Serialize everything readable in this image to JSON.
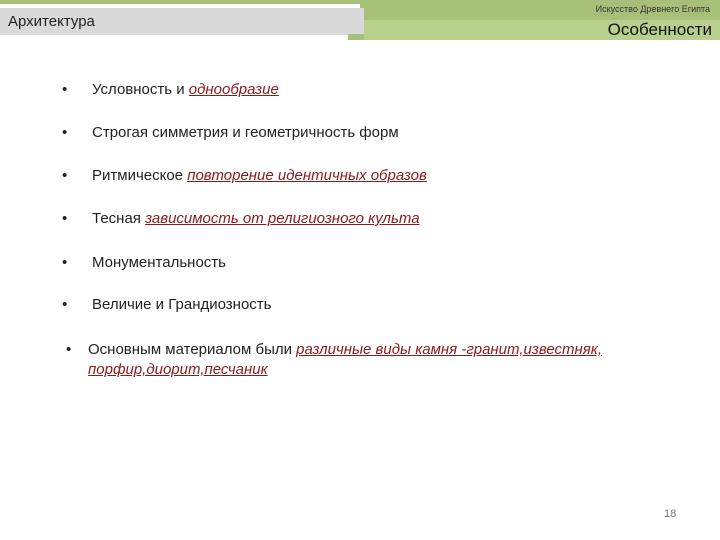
{
  "header": {
    "section": "Архитектура",
    "caption": "Искусство Древнего Египта",
    "title": "Особенности"
  },
  "bullets": [
    {
      "plain": "Условность и ",
      "underlined": "однообразие",
      "tail": ""
    },
    {
      "plain": "Строгая симметрия и геометричность форм",
      "underlined": "",
      "tail": ""
    },
    {
      "plain": "Ритмическое ",
      "underlined": "повторение идентичных образов",
      "tail": ""
    },
    {
      "plain": "Тесная ",
      "underlined": "зависимость от  религиозного культа",
      "tail": ""
    },
    {
      "plain": "Монументальность",
      "underlined": "",
      "tail": ""
    },
    {
      "plain": "Величие и  Грандиозность",
      "underlined": "",
      "tail": ""
    }
  ],
  "material": {
    "plain": "Основным материалом были ",
    "underlined": "различные виды камня -гранит,известняк,",
    "underlined2": "порфир,диорит,песчаник"
  },
  "bullet_symbol": "•",
  "page_number": "18",
  "colors": {
    "accent_green": "#a6c07a",
    "band_gray": "#d9d9d9",
    "underline_red": "#8b1a1a"
  }
}
